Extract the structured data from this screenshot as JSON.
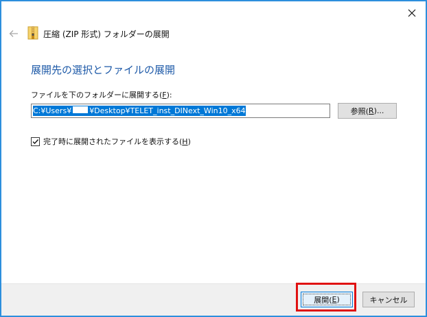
{
  "window": {
    "nav_title": "圧縮 (ZIP 形式) フォルダーの展開",
    "heading": "展開先の選択とファイルの展開",
    "close_icon": "close-icon",
    "back_icon": "back-arrow-icon",
    "folder_icon": "zip-folder-icon"
  },
  "destination": {
    "label_prefix": "ファイルを下のフォルダーに展開する(",
    "label_key": "F",
    "label_suffix": "):",
    "path_part1": "C:¥Users¥",
    "path_part2": "¥Desktop¥TELET_inst_DINext_Win10_x64",
    "browse_prefix": "参照(",
    "browse_key": "R",
    "browse_suffix": ")..."
  },
  "option": {
    "checked": true,
    "label_prefix": "完了時に展開されたファイルを表示する(",
    "label_key": "H",
    "label_suffix": ")"
  },
  "footer": {
    "extract_prefix": "展開(",
    "extract_key": "E",
    "extract_suffix": ")",
    "cancel_label": "キャンセル"
  },
  "colors": {
    "window_border": "#2d8fdd",
    "heading": "#1e5aa8",
    "selection": "#0078d7",
    "highlight_box": "#e01010"
  }
}
